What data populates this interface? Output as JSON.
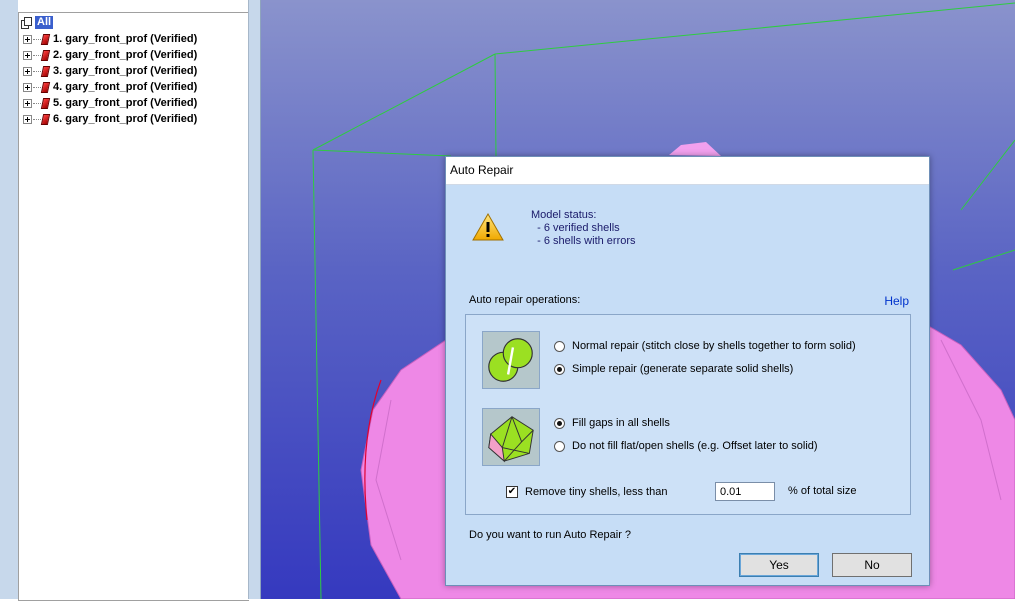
{
  "tree": {
    "root_label": "All",
    "items": [
      {
        "label": "1. gary_front_prof (Verified)"
      },
      {
        "label": "2. gary_front_prof (Verified)"
      },
      {
        "label": "3. gary_front_prof (Verified)"
      },
      {
        "label": "4. gary_front_prof (Verified)"
      },
      {
        "label": "5. gary_front_prof (Verified)"
      },
      {
        "label": "6. gary_front_prof (Verified)"
      }
    ]
  },
  "dialog": {
    "title": "Auto Repair",
    "status_heading": "Model status:",
    "status_lines": [
      "  - 6 verified shells",
      "  - 6 shells with errors"
    ],
    "operations_label": "Auto repair operations:",
    "help_label": "Help",
    "shell_options": {
      "normal": "Normal repair (stitch close by shells together to form solid)",
      "simple": "Simple repair (generate separate solid shells)",
      "selected": "simple"
    },
    "gap_options": {
      "fill": "Fill gaps in all shells",
      "no_fill": "Do not fill flat/open shells (e.g. Offset later to solid)",
      "selected": "fill"
    },
    "remove_tiny": {
      "label": "Remove tiny shells, less than",
      "checked": true,
      "value": "0.01",
      "suffix": "% of total size"
    },
    "question": "Do you want to run Auto Repair ?",
    "yes_label": "Yes",
    "no_label": "No"
  },
  "colors": {
    "viewport_top": "#8a93cc",
    "viewport_bottom": "#3539bf",
    "bounding_box": "#2ecc40",
    "mesh": "#f08ae8",
    "dialog_bg": "#c6ddf6",
    "help_link": "#0033cc"
  }
}
